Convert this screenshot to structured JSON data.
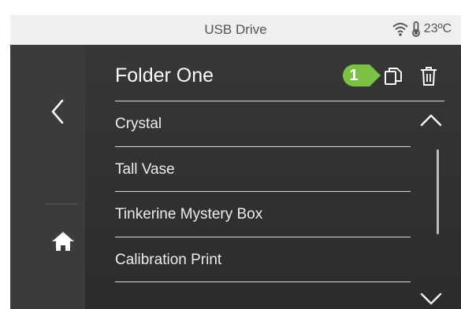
{
  "status": {
    "title": "USB Drive",
    "temperature": "23ºC",
    "icons": [
      "wifi-icon",
      "thermometer-icon"
    ]
  },
  "sidebar": {
    "icons": [
      "back-arrow-icon",
      "home-icon"
    ]
  },
  "header": {
    "folder_name": "Folder One",
    "callout_number": "1",
    "callout_color": "#7cc242",
    "icons": [
      "copy-icon",
      "trash-icon"
    ]
  },
  "files": [
    {
      "name": "Crystal"
    },
    {
      "name": "Tall Vase"
    },
    {
      "name": "Tinkerine Mystery Box"
    },
    {
      "name": "Calibration Print"
    }
  ],
  "scroll": {
    "icons": [
      "chevron-up-icon",
      "chevron-down-icon"
    ]
  }
}
